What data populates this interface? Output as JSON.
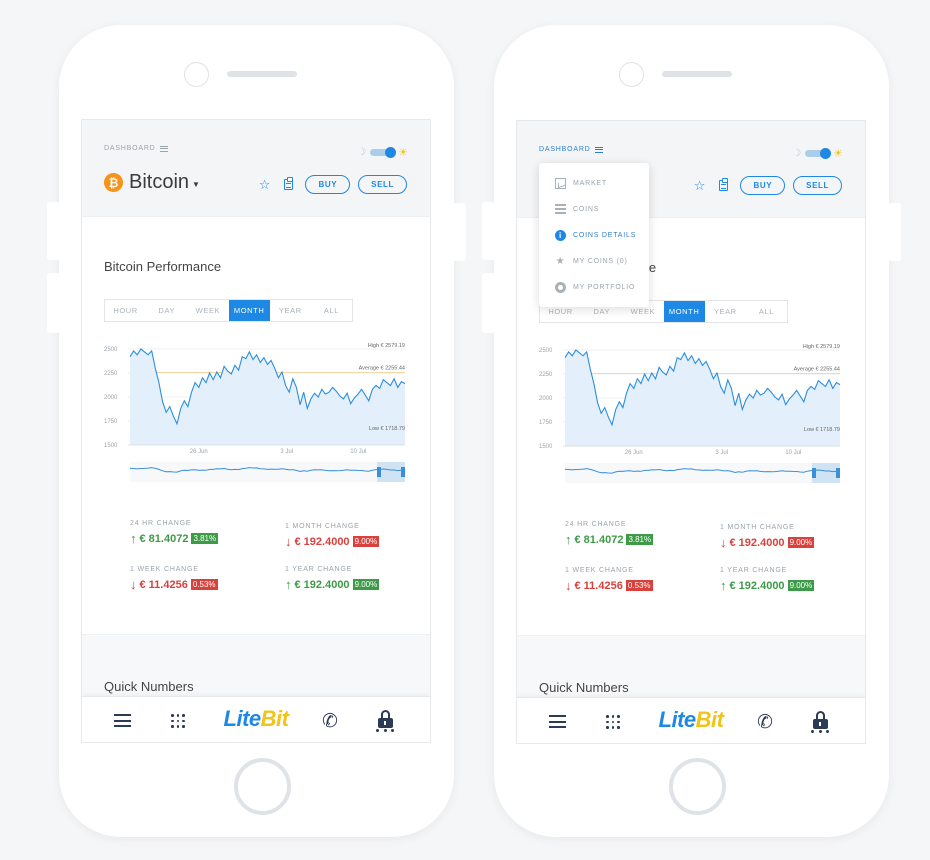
{
  "header": {
    "dashboard_label": "DASHBOARD",
    "coin_name": "Bitcoin",
    "coin_symbol_glyph": "₿",
    "buy_label": "BUY",
    "sell_label": "SELL"
  },
  "performance": {
    "title": "Bitcoin Performance",
    "timeframes": [
      "HOUR",
      "DAY",
      "WEEK",
      "MONTH",
      "YEAR",
      "ALL"
    ],
    "selected_timeframe": "MONTH"
  },
  "chart_data": {
    "type": "area",
    "y_ticks": [
      "2500",
      "2250",
      "2000",
      "1750",
      "1500"
    ],
    "ylim": [
      1500,
      2500
    ],
    "x_ticks": [
      "26 Jun",
      "3 Jul",
      "10 Jul"
    ],
    "high_label": "High € 2579.19",
    "average_label": "Average € 2255.44",
    "low_label": "Low € 1718.79",
    "high": 2579.19,
    "average": 2255.44,
    "low": 1718.79,
    "values": [
      2420,
      2480,
      2440,
      2500,
      2470,
      2440,
      2480,
      2300,
      2150,
      1950,
      1840,
      1900,
      1800,
      1720,
      1880,
      1960,
      1900,
      2050,
      2150,
      2100,
      2200,
      2150,
      2250,
      2180,
      2260,
      2200,
      2320,
      2270,
      2240,
      2330,
      2280,
      2420,
      2400,
      2470,
      2390,
      2440,
      2360,
      2410,
      2340,
      2380,
      2300,
      2200,
      2260,
      2120,
      2050,
      2190,
      2100,
      1920,
      2050,
      1880,
      1980,
      2040,
      2000,
      2080,
      2030,
      2050,
      2100,
      2060,
      2010,
      1980,
      2040,
      1930,
      1990,
      2030,
      2080,
      2020,
      1960,
      2080,
      2120,
      2090,
      2180,
      2150,
      2120,
      2190,
      2100,
      2160,
      2140
    ]
  },
  "changes": [
    {
      "label": "24 HR CHANGE",
      "value": "€ 81.4072",
      "pct": "3.81%",
      "dir": "up",
      "arrow": "↑"
    },
    {
      "label": "1 MONTH CHANGE",
      "value": "€ 192.4000",
      "pct": "9.00%",
      "dir": "down",
      "arrow": "↓"
    },
    {
      "label": "1 WEEK CHANGE",
      "value": "€ 11.4256",
      "pct": "0.53%",
      "dir": "down",
      "arrow": "↓"
    },
    {
      "label": "1 YEAR CHANGE",
      "value": "€ 192.4000",
      "pct": "9.00%",
      "dir": "up",
      "arrow": "↑"
    }
  ],
  "quick_numbers_title": "Quick Numbers",
  "tabbar": {
    "logo_lite": "Lite",
    "logo_bit": "Bit"
  },
  "dropdown": {
    "items": [
      {
        "label": "MARKET",
        "active": false
      },
      {
        "label": "COINS",
        "active": false
      },
      {
        "label": "COINS DETAILS",
        "active": true
      },
      {
        "label": "MY COINS (0)",
        "active": false
      },
      {
        "label": "MY PORTFOLIO",
        "active": false
      }
    ]
  },
  "colors": {
    "accent": "#1e88e5",
    "up": "#3d9a47",
    "down": "#d9413d",
    "bitcoin": "#f7931a",
    "logo_bit": "#f0c419"
  }
}
